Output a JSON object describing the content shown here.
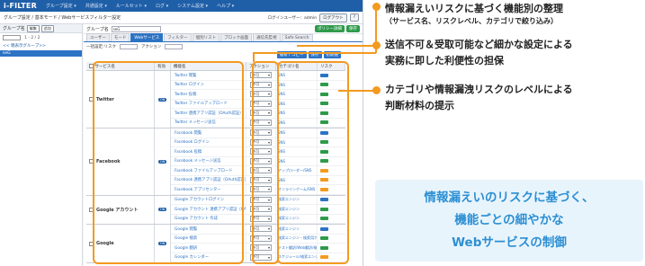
{
  "topbar": {
    "logo": "i-FILTER",
    "menus": [
      "グループ設定 ▾",
      "共通設定 ▾",
      "ルールセット ▾",
      "ログ ▾",
      "システム設定 ▾",
      "ヘルプ ▾"
    ]
  },
  "breadcrumb": "グループ設定 / 基本モード / Webサービスフィルター設定",
  "login": {
    "label": "ログインユーザー：admin",
    "logout": "ログアウト",
    "help": "?"
  },
  "sidebar": {
    "title": "グループ名",
    "edit": "編集",
    "add": "追加",
    "pager": "1 - 2 / 2",
    "back_link": "<< 親表示グループ>>",
    "selected": "seG"
  },
  "main": {
    "group_label": "グループ名",
    "group_value": "seG",
    "policy_btn": "ポリシー詳細",
    "save_btn": "保存",
    "tabs": [
      "ユーザー",
      "モード",
      "Webサービス",
      "フィルター",
      "個別リスト",
      "ブロック画面",
      "通信先監視",
      "Safe Search"
    ],
    "active_tab": 2,
    "filter_risk_label": "一括設定:リスク",
    "filter_action_label": "アクション",
    "action_buttons": [
      "簡易 / コピー",
      "保存",
      "初期値"
    ]
  },
  "grid": {
    "headers": {
      "service": "サービス名",
      "active": "有効",
      "function": "機能名",
      "action": "アクション",
      "category": "カテゴリ名",
      "risk": "リスク"
    },
    "groups": [
      {
        "name": "Twitter",
        "toggle": "ON",
        "rows": [
          {
            "fn": "Twitter 閲覧",
            "action": "許可",
            "cat": "SNS",
            "risk": "blue"
          },
          {
            "fn": "Twitter ログイン",
            "action": "許可",
            "cat": "SNS",
            "risk": "green"
          },
          {
            "fn": "Twitter 投稿",
            "action": "許可",
            "cat": "SNS",
            "risk": "green"
          },
          {
            "fn": "Twitter ファイルアップロード",
            "action": "許可",
            "cat": "SNS",
            "risk": "green"
          },
          {
            "fn": "Twitter 連携アプリ認証（OAuth認証）",
            "action": "許可",
            "cat": "SNS",
            "risk": "green"
          },
          {
            "fn": "Twitter メッセージ送信",
            "action": "許可",
            "cat": "SNS",
            "risk": "green"
          }
        ]
      },
      {
        "name": "Facebook",
        "toggle": "ON",
        "rows": [
          {
            "fn": "Facebook 閲覧",
            "action": "許可",
            "cat": "SNS",
            "risk": "blue"
          },
          {
            "fn": "Facebook ログイン",
            "action": "許可",
            "cat": "SNS",
            "risk": "green"
          },
          {
            "fn": "Facebook 投稿",
            "action": "許可",
            "cat": "SNS",
            "risk": "green"
          },
          {
            "fn": "Facebook メッセージ送信",
            "action": "許可",
            "cat": "SNS",
            "risk": "green"
          },
          {
            "fn": "Facebook ファイルアップロード",
            "action": "許可",
            "cat": "アップローダー/SNS",
            "risk": "orange"
          },
          {
            "fn": "Facebook 連携アプリ認証（OAuth認証）",
            "action": "許可",
            "cat": "SNS",
            "risk": "orange"
          },
          {
            "fn": "Facebook アプリセンター",
            "action": "許可",
            "cat": "オンラインゲーム/SNS",
            "risk": "orange"
          }
        ]
      },
      {
        "name": "Google アカウント",
        "toggle": "ON",
        "rows": [
          {
            "fn": "Google アカウントログイン",
            "action": "許可",
            "cat": "検索エンジン",
            "risk": "blue"
          },
          {
            "fn": "Google アカウント 連携アプリ認証（OAuth認証）",
            "action": "許可",
            "cat": "検索エンジン",
            "risk": "green"
          },
          {
            "fn": "Google アカウント 作成",
            "action": "許可",
            "cat": "検索エンジン",
            "risk": "green"
          }
        ]
      },
      {
        "name": "Google",
        "toggle": "ON",
        "rows": [
          {
            "fn": "Google 閲覧",
            "action": "許可",
            "cat": "検索エンジン",
            "risk": "blue"
          },
          {
            "fn": "Google 検索",
            "action": "許可",
            "cat": "検索エンジン・検索用ポータル",
            "risk": "green"
          },
          {
            "fn": "Google 翻訳",
            "action": "許可",
            "cat": "テスト翻訳/Web翻訳/検索エンジン",
            "risk": "green"
          },
          {
            "fn": "Google カレンダー",
            "action": "許可",
            "cat": "スケジュール/検索エンジン",
            "risk": "orange"
          }
        ]
      }
    ]
  },
  "annotations": {
    "a1_title": "情報漏えいリスクに基づく機能別の整理",
    "a1_sub": "（サービス名、リスクレベル、カテゴリで絞り込み）",
    "a2_line1": "送信不可＆受取可能など細かな設定による",
    "a2_line2": "実務に即した利便性の担保",
    "a3_line1": "カテゴリや情報漏洩リスクのレベルによる",
    "a3_line2": "判断材料の提示"
  },
  "callout": {
    "line1": "情報漏えいのリスクに基づく、",
    "line2": "機能ごとの細やかな",
    "line3": "Webサービスの制御"
  },
  "colors": {
    "highlight": "#f39a1f",
    "brand_blue": "#1f5fa8",
    "callout_text": "#2d8fd3",
    "risk_blue": "#2d73c4",
    "risk_green": "#2e9a4b",
    "risk_orange": "#f39a1f"
  }
}
